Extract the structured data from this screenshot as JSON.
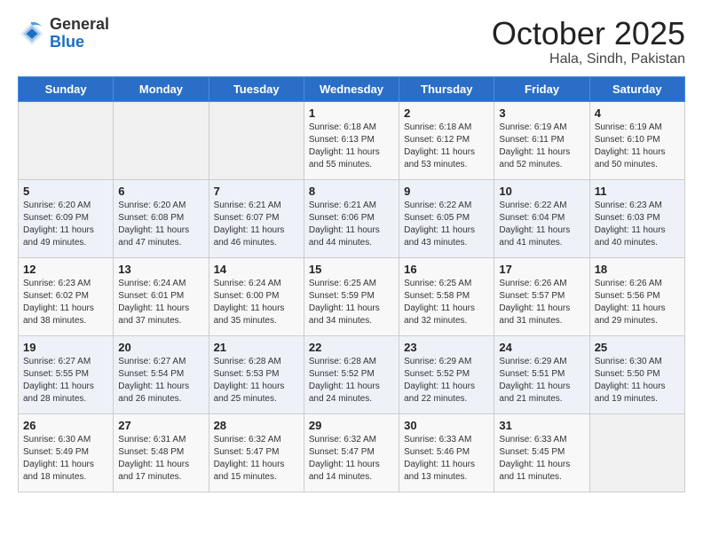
{
  "header": {
    "logo_general": "General",
    "logo_blue": "Blue",
    "month": "October 2025",
    "location": "Hala, Sindh, Pakistan"
  },
  "weekdays": [
    "Sunday",
    "Monday",
    "Tuesday",
    "Wednesday",
    "Thursday",
    "Friday",
    "Saturday"
  ],
  "weeks": [
    [
      {
        "day": "",
        "info": ""
      },
      {
        "day": "",
        "info": ""
      },
      {
        "day": "",
        "info": ""
      },
      {
        "day": "1",
        "info": "Sunrise: 6:18 AM\nSunset: 6:13 PM\nDaylight: 11 hours\nand 55 minutes."
      },
      {
        "day": "2",
        "info": "Sunrise: 6:18 AM\nSunset: 6:12 PM\nDaylight: 11 hours\nand 53 minutes."
      },
      {
        "day": "3",
        "info": "Sunrise: 6:19 AM\nSunset: 6:11 PM\nDaylight: 11 hours\nand 52 minutes."
      },
      {
        "day": "4",
        "info": "Sunrise: 6:19 AM\nSunset: 6:10 PM\nDaylight: 11 hours\nand 50 minutes."
      }
    ],
    [
      {
        "day": "5",
        "info": "Sunrise: 6:20 AM\nSunset: 6:09 PM\nDaylight: 11 hours\nand 49 minutes."
      },
      {
        "day": "6",
        "info": "Sunrise: 6:20 AM\nSunset: 6:08 PM\nDaylight: 11 hours\nand 47 minutes."
      },
      {
        "day": "7",
        "info": "Sunrise: 6:21 AM\nSunset: 6:07 PM\nDaylight: 11 hours\nand 46 minutes."
      },
      {
        "day": "8",
        "info": "Sunrise: 6:21 AM\nSunset: 6:06 PM\nDaylight: 11 hours\nand 44 minutes."
      },
      {
        "day": "9",
        "info": "Sunrise: 6:22 AM\nSunset: 6:05 PM\nDaylight: 11 hours\nand 43 minutes."
      },
      {
        "day": "10",
        "info": "Sunrise: 6:22 AM\nSunset: 6:04 PM\nDaylight: 11 hours\nand 41 minutes."
      },
      {
        "day": "11",
        "info": "Sunrise: 6:23 AM\nSunset: 6:03 PM\nDaylight: 11 hours\nand 40 minutes."
      }
    ],
    [
      {
        "day": "12",
        "info": "Sunrise: 6:23 AM\nSunset: 6:02 PM\nDaylight: 11 hours\nand 38 minutes."
      },
      {
        "day": "13",
        "info": "Sunrise: 6:24 AM\nSunset: 6:01 PM\nDaylight: 11 hours\nand 37 minutes."
      },
      {
        "day": "14",
        "info": "Sunrise: 6:24 AM\nSunset: 6:00 PM\nDaylight: 11 hours\nand 35 minutes."
      },
      {
        "day": "15",
        "info": "Sunrise: 6:25 AM\nSunset: 5:59 PM\nDaylight: 11 hours\nand 34 minutes."
      },
      {
        "day": "16",
        "info": "Sunrise: 6:25 AM\nSunset: 5:58 PM\nDaylight: 11 hours\nand 32 minutes."
      },
      {
        "day": "17",
        "info": "Sunrise: 6:26 AM\nSunset: 5:57 PM\nDaylight: 11 hours\nand 31 minutes."
      },
      {
        "day": "18",
        "info": "Sunrise: 6:26 AM\nSunset: 5:56 PM\nDaylight: 11 hours\nand 29 minutes."
      }
    ],
    [
      {
        "day": "19",
        "info": "Sunrise: 6:27 AM\nSunset: 5:55 PM\nDaylight: 11 hours\nand 28 minutes."
      },
      {
        "day": "20",
        "info": "Sunrise: 6:27 AM\nSunset: 5:54 PM\nDaylight: 11 hours\nand 26 minutes."
      },
      {
        "day": "21",
        "info": "Sunrise: 6:28 AM\nSunset: 5:53 PM\nDaylight: 11 hours\nand 25 minutes."
      },
      {
        "day": "22",
        "info": "Sunrise: 6:28 AM\nSunset: 5:52 PM\nDaylight: 11 hours\nand 24 minutes."
      },
      {
        "day": "23",
        "info": "Sunrise: 6:29 AM\nSunset: 5:52 PM\nDaylight: 11 hours\nand 22 minutes."
      },
      {
        "day": "24",
        "info": "Sunrise: 6:29 AM\nSunset: 5:51 PM\nDaylight: 11 hours\nand 21 minutes."
      },
      {
        "day": "25",
        "info": "Sunrise: 6:30 AM\nSunset: 5:50 PM\nDaylight: 11 hours\nand 19 minutes."
      }
    ],
    [
      {
        "day": "26",
        "info": "Sunrise: 6:30 AM\nSunset: 5:49 PM\nDaylight: 11 hours\nand 18 minutes."
      },
      {
        "day": "27",
        "info": "Sunrise: 6:31 AM\nSunset: 5:48 PM\nDaylight: 11 hours\nand 17 minutes."
      },
      {
        "day": "28",
        "info": "Sunrise: 6:32 AM\nSunset: 5:47 PM\nDaylight: 11 hours\nand 15 minutes."
      },
      {
        "day": "29",
        "info": "Sunrise: 6:32 AM\nSunset: 5:47 PM\nDaylight: 11 hours\nand 14 minutes."
      },
      {
        "day": "30",
        "info": "Sunrise: 6:33 AM\nSunset: 5:46 PM\nDaylight: 11 hours\nand 13 minutes."
      },
      {
        "day": "31",
        "info": "Sunrise: 6:33 AM\nSunset: 5:45 PM\nDaylight: 11 hours\nand 11 minutes."
      },
      {
        "day": "",
        "info": ""
      }
    ]
  ]
}
